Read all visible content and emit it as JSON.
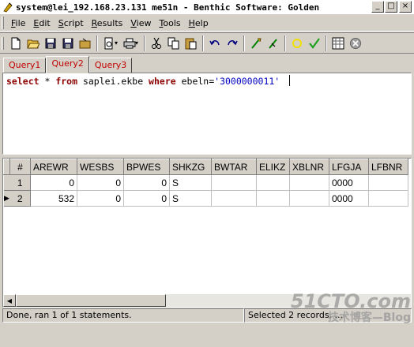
{
  "window": {
    "title": "system@lei_192.168.23.131 me51n - Benthic Software: Golden",
    "min_label": "_",
    "max_label": "□",
    "close_label": "×"
  },
  "menu": {
    "items": [
      "File",
      "Edit",
      "Script",
      "Results",
      "View",
      "Tools",
      "Help"
    ],
    "mnemonics": [
      "F",
      "E",
      "S",
      "R",
      "V",
      "T",
      "H"
    ]
  },
  "toolbar": {
    "icons": [
      "new-file-icon",
      "open-folder-icon",
      "save-icon",
      "save-all-icon",
      "open-script-icon",
      "print-preview-icon",
      "print-icon",
      "cut-icon",
      "copy-icon",
      "paste-icon",
      "undo-icon",
      "redo-icon",
      "execute-icon",
      "execute-step-icon",
      "commit-icon",
      "check-icon",
      "grid-options-icon",
      "cancel-icon"
    ]
  },
  "tabs": [
    "Query1",
    "Query2",
    "Query3"
  ],
  "active_tab": 1,
  "editor": {
    "kw_select": "select",
    "star": " * ",
    "kw_from": "from",
    "table": " saplei.ekbe ",
    "kw_where": "where",
    "cond": " ebeln=",
    "value": "'3000000011'"
  },
  "grid": {
    "columns": [
      "#",
      "AREWR",
      "WESBS",
      "BPWES",
      "SHKZG",
      "BWTAR",
      "ELIKZ",
      "XBLNR",
      "LFGJA",
      "LFBNR"
    ],
    "rows": [
      [
        "1",
        "0",
        "0",
        "0",
        "S",
        "",
        "",
        "",
        "0000",
        ""
      ],
      [
        "2",
        "532",
        "0",
        "0",
        "S",
        "",
        "",
        "",
        "0000",
        ""
      ]
    ],
    "current_row_indicator": "▶"
  },
  "status": {
    "message": "Done, ran 1 of 1 statements.",
    "selection": "Selected 2 records, ..."
  },
  "watermark": {
    "line1": "51CTO.com",
    "line2": "技术博客—Blog"
  },
  "colors": {
    "keyword": "#8b0000",
    "string": "#0000c0",
    "tab_text": "#c00000",
    "face": "#d4d0c8"
  }
}
